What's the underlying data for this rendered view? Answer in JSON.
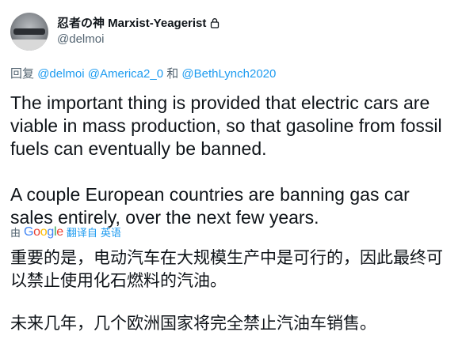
{
  "author": {
    "name": "忍者の神 Marxist-Yeagerist",
    "handle": "@delmoi",
    "lock_icon": "lock-icon"
  },
  "reply": {
    "prefix": "回复",
    "mentions": [
      "@delmoi",
      "@America2_0",
      "@BethLynch2020"
    ],
    "and": "和"
  },
  "tweet": {
    "paragraphs": [
      "The important thing is provided that electric cars are viable in mass production, so that gasoline from fossil fuels can eventually be banned.",
      "A couple European countries are banning gas car sales entirely, over the next few years."
    ]
  },
  "translation": {
    "by": "由",
    "brand_letters": [
      "G",
      "o",
      "o",
      "g",
      "l",
      "e"
    ],
    "from_label": "翻译自",
    "language": "英语",
    "paragraphs": [
      "重要的是，电动汽车在大规模生产中是可行的，因此最终可以禁止使用化石燃料的汽油。",
      "未来几年，几个欧洲国家将完全禁止汽油车销售。"
    ]
  },
  "colors": {
    "text": "#0f1419",
    "secondary": "#536471",
    "link": "#1d9bf0"
  }
}
